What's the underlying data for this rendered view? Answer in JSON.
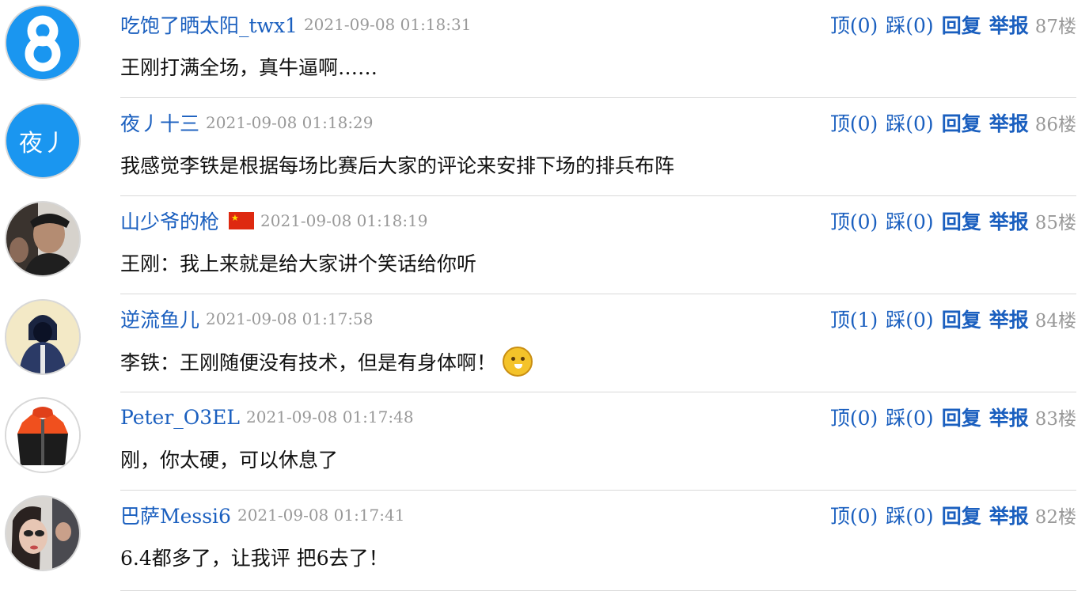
{
  "comments": [
    {
      "username": "吃饱了晒太阳_twx1",
      "time": "2021-09-08 01:18:31",
      "up": "顶(0)",
      "down": "踩(0)",
      "reply": "回复",
      "report": "举报",
      "floor": "87楼",
      "text": "王刚打满全场，真牛逼啊……",
      "avatar": "number-8-avatar"
    },
    {
      "username": "夜丿十三",
      "time": "2021-09-08 01:18:29",
      "up": "顶(0)",
      "down": "踩(0)",
      "reply": "回复",
      "report": "举报",
      "floor": "86楼",
      "text": "我感觉李铁是根据每场比赛后大家的评论来安排下场的排兵布阵",
      "avatar_text": "夜丿"
    },
    {
      "username": "山少爷的枪",
      "time": "2021-09-08 01:18:19",
      "up": "顶(0)",
      "down": "踩(0)",
      "reply": "回复",
      "report": "举报",
      "floor": "85楼",
      "text": "王刚：我上来就是给大家讲个笑话给你听",
      "flag": "china-flag-icon"
    },
    {
      "username": "逆流鱼儿",
      "time": "2021-09-08 01:17:58",
      "up": "顶(1)",
      "down": "踩(0)",
      "reply": "回复",
      "report": "举报",
      "floor": "84楼",
      "text": "李铁：王刚随便没有技术，但是有身体啊！",
      "emoji": "dog-emoji-icon"
    },
    {
      "username": "Peter_O3EL",
      "time": "2021-09-08 01:17:48",
      "up": "顶(0)",
      "down": "踩(0)",
      "reply": "回复",
      "report": "举报",
      "floor": "83楼",
      "text": "刚，你太硬，可以休息了"
    },
    {
      "username": "巴萨Messi6",
      "time": "2021-09-08 01:17:41",
      "up": "顶(0)",
      "down": "踩(0)",
      "reply": "回复",
      "report": "举报",
      "floor": "82楼",
      "text": "6.4都多了，让我评 把6去了！"
    }
  ],
  "colors": {
    "link": "#1a5fbf",
    "muted": "#999999",
    "text": "#111111",
    "divider": "#d9d9d9",
    "avatar_blue": "#1a96f0"
  }
}
